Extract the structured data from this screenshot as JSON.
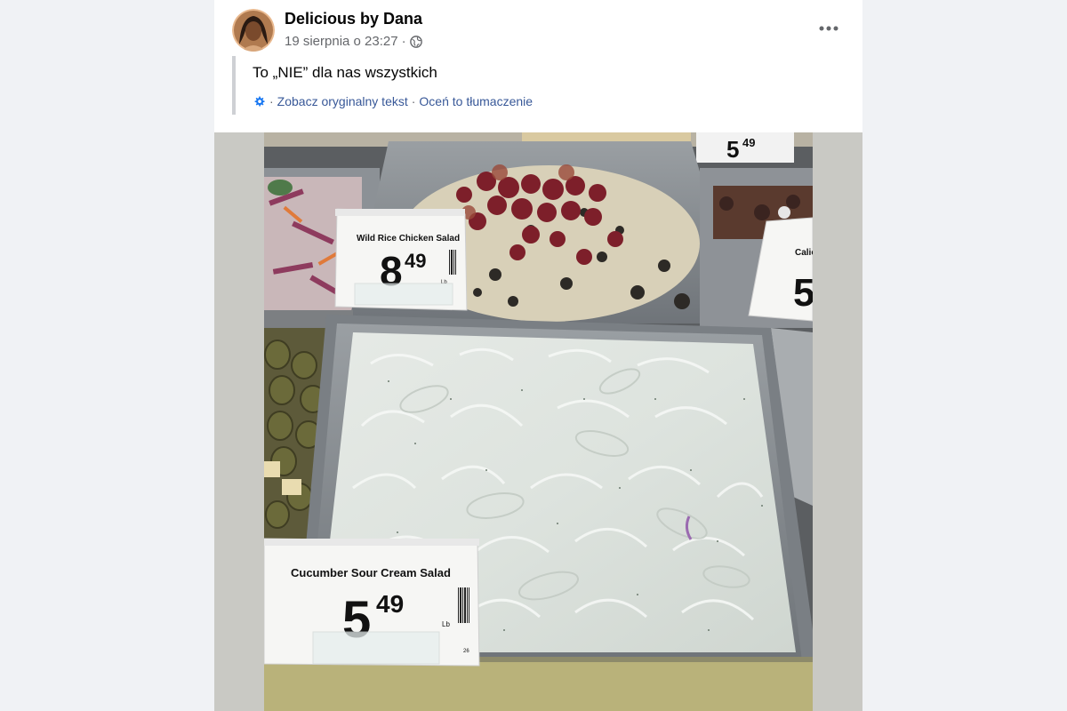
{
  "post": {
    "author": "Delicious by Dana",
    "date": "19 sierpnia o 23:27",
    "date_separator": "·",
    "audience_icon": "globe-icon",
    "more_icon": "more-dots-icon",
    "text": "To „NIE” dla nas wszystkich",
    "translation": {
      "icon": "gear-icon",
      "separator": "·",
      "see_original": "Zobacz oryginalny tekst",
      "rate_translation": "Oceń to tłumaczenie"
    }
  },
  "photo": {
    "labels": [
      {
        "name": "Wild Rice Chicken Salad",
        "price_dollars": "8",
        "price_cents": "49",
        "unit": "Lb"
      },
      {
        "name": "Cucumber Sour Cream Salad",
        "price_dollars": "5",
        "price_cents": "49",
        "unit": "Lb",
        "code": "26"
      },
      {
        "name": "Calico",
        "price_dollars": "5"
      },
      {
        "price_dollars": "5",
        "price_cents": "49"
      }
    ]
  },
  "colors": {
    "link": "#385898",
    "muted": "#65676b",
    "text": "#050505",
    "page_bg": "#f0f2f5",
    "card_bg": "#ffffff"
  }
}
